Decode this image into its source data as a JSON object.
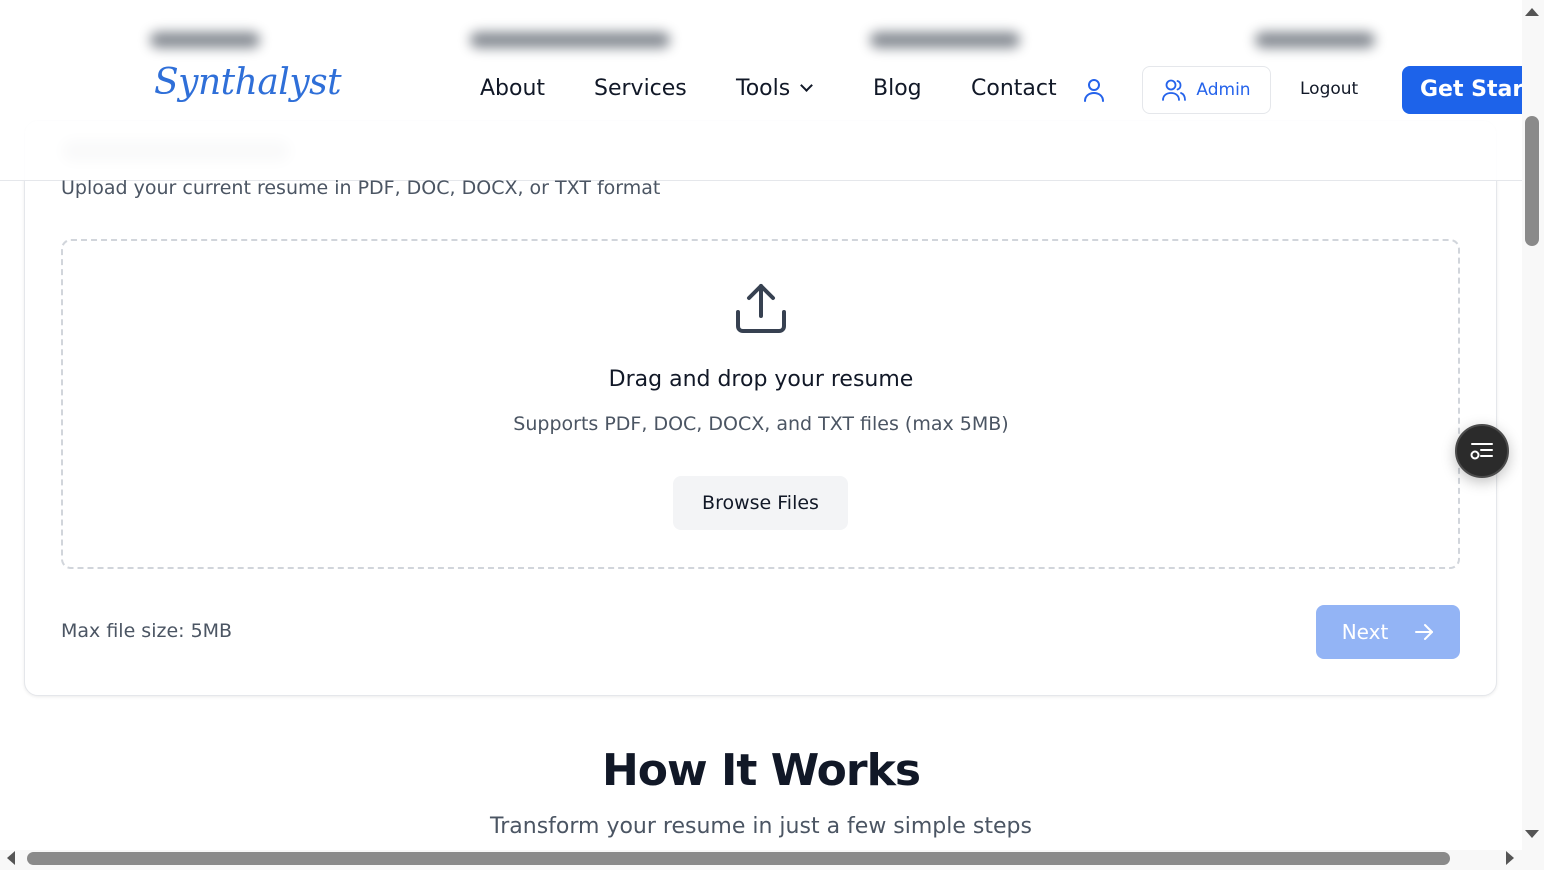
{
  "header": {
    "logo": "Synthalyst",
    "nav": [
      {
        "label": "About"
      },
      {
        "label": "Services"
      },
      {
        "label": "Tools"
      },
      {
        "label": "Blog"
      },
      {
        "label": "Contact"
      }
    ],
    "admin_label": "Admin",
    "logout_label": "Logout",
    "get_started_label": "Get Started"
  },
  "upload": {
    "subtitle": "Upload your current resume in PDF, DOC, DOCX, or TXT format",
    "dropzone_title": "Drag and drop your resume",
    "dropzone_subtitle": "Supports PDF, DOC, DOCX, and TXT files (max 5MB)",
    "browse_label": "Browse Files",
    "max_size": "Max file size: 5MB",
    "next_label": "Next"
  },
  "how_it_works": {
    "title": "How It Works",
    "subtitle": "Transform your resume in just a few simple steps"
  },
  "colors": {
    "accent": "#1d63ea",
    "next_disabled": "#93b4f5",
    "logo": "#2f6fd8"
  },
  "icons": {
    "user": "user-icon",
    "admin": "users-icon",
    "upload": "upload-icon",
    "next": "arrow-right-icon",
    "float": "list-icon",
    "tools": "chevron-down-icon"
  }
}
